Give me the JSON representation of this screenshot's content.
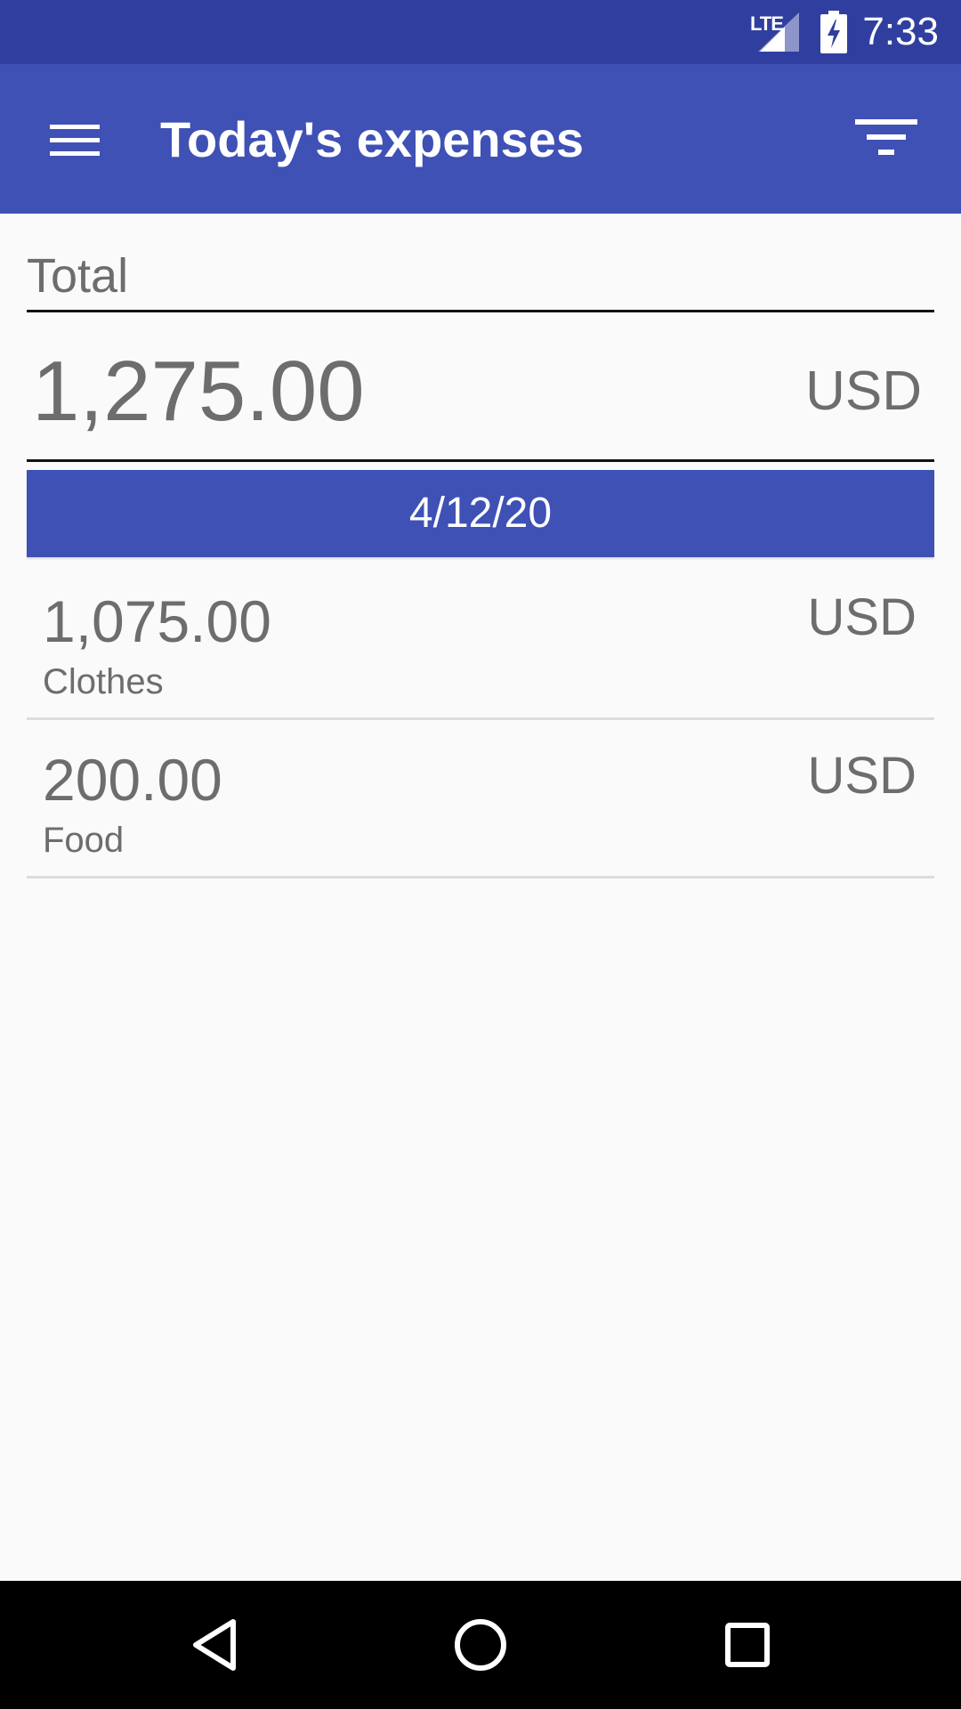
{
  "status_bar": {
    "network": "LTE",
    "time": "7:33"
  },
  "app_bar": {
    "title": "Today's expenses",
    "menu_icon": "hamburger-menu-icon",
    "filter_icon": "filter-icon"
  },
  "total": {
    "label": "Total",
    "amount": "1,275.00",
    "currency": "USD"
  },
  "date_header": "4/12/20",
  "expenses": [
    {
      "amount": "1,075.00",
      "currency": "USD",
      "category": "Clothes"
    },
    {
      "amount": "200.00",
      "currency": "USD",
      "category": "Food"
    }
  ],
  "nav_bar": {
    "back_icon": "back-triangle-icon",
    "home_icon": "home-circle-icon",
    "recents_icon": "recents-square-icon"
  },
  "colors": {
    "primary": "#3f51b5",
    "primary_dark": "#303f9f",
    "text_secondary": "#6d6d6d",
    "background": "#fafafa"
  }
}
